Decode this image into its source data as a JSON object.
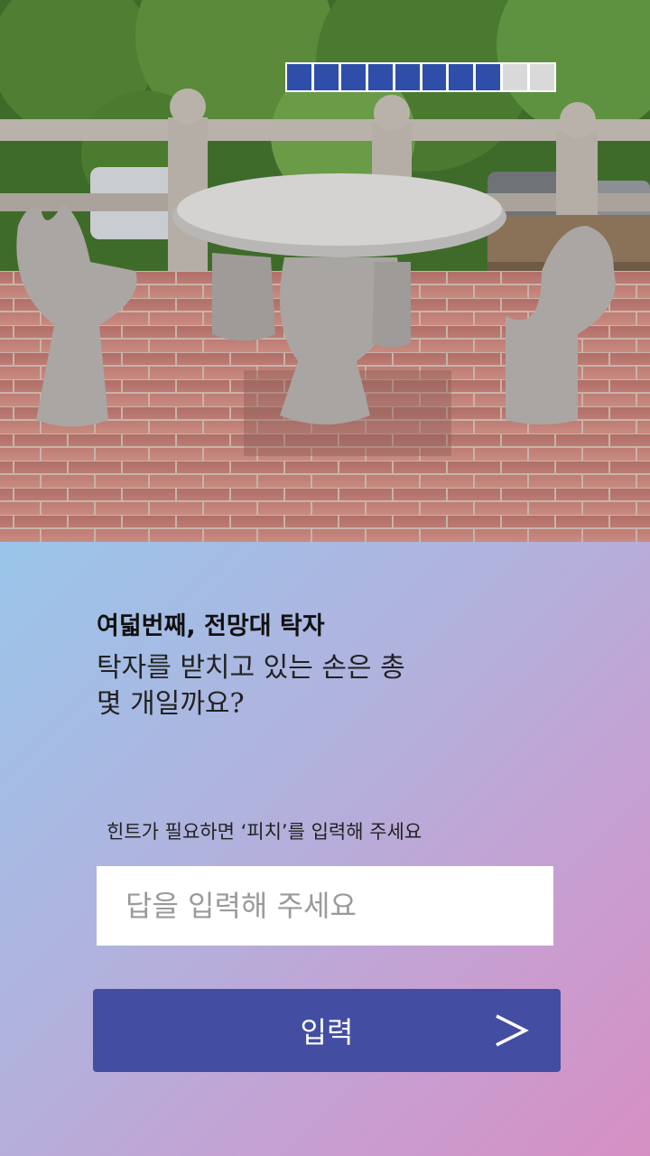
{
  "photo": {
    "subject": "stone hand-shaped chairs around a round granite table on a brick observation deck",
    "icon": "hand-chairs-photo"
  },
  "progress": {
    "total_steps": 10,
    "completed_steps": 8,
    "fill_color": "#2f4ea9",
    "empty_color": "#d9d9d9"
  },
  "question": {
    "title": "여덟번째, 전망대 탁자",
    "line1": "탁자를 받치고 있는 손은 총",
    "line2": "몇 개일까요?"
  },
  "hint": {
    "text": "힌트가 필요하면 ‘피치’를 입력해 주세요"
  },
  "answer": {
    "placeholder": "답을 입력해 주세요",
    "value": ""
  },
  "submit": {
    "label": "입력",
    "icon": "chevron-right-icon",
    "color": "#434da1"
  }
}
